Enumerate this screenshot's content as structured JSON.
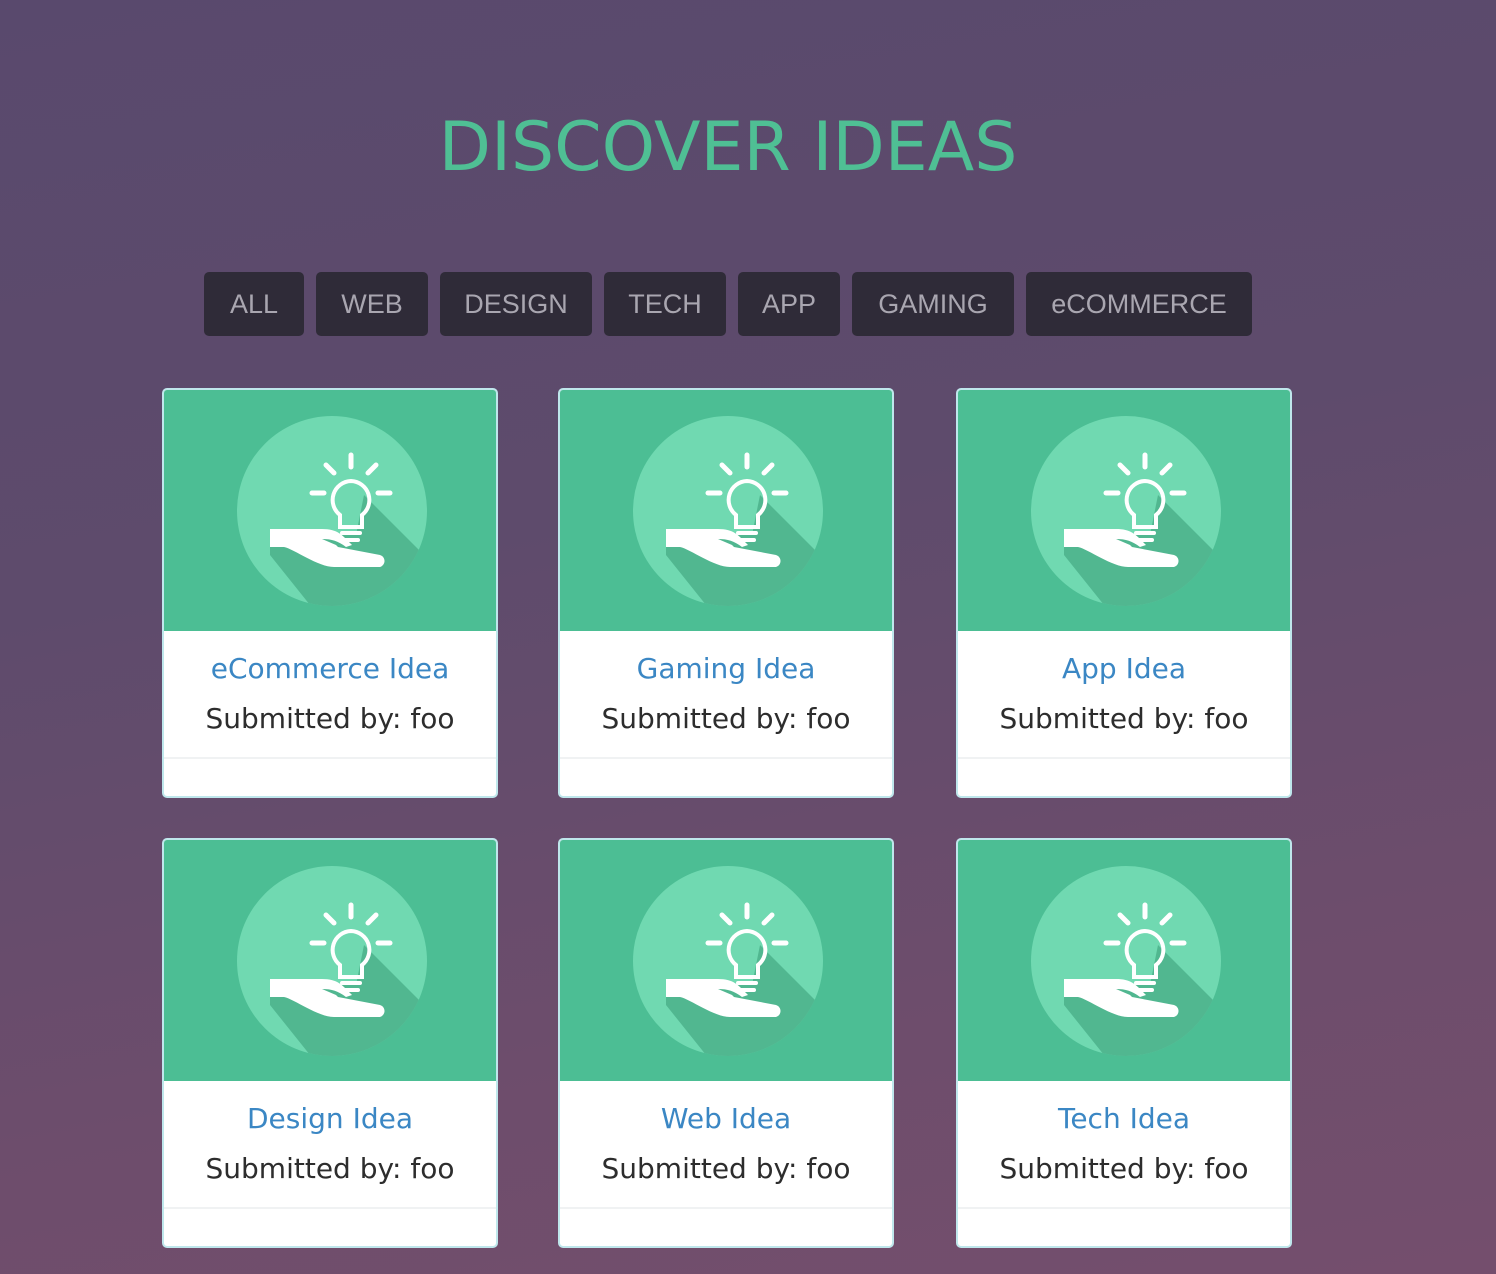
{
  "header": {
    "title": "DISCOVER IDEAS"
  },
  "filters": [
    {
      "label": "ALL"
    },
    {
      "label": "WEB"
    },
    {
      "label": "DESIGN"
    },
    {
      "label": "TECH"
    },
    {
      "label": "APP"
    },
    {
      "label": "GAMING"
    },
    {
      "label": "eCOMMERCE"
    }
  ],
  "cards": [
    {
      "title": "eCommerce Idea",
      "submitted": "Submitted by: foo",
      "icon": "lightbulb-hand-icon"
    },
    {
      "title": "Gaming Idea",
      "submitted": "Submitted by: foo",
      "icon": "lightbulb-hand-icon"
    },
    {
      "title": "App Idea",
      "submitted": "Submitted by: foo",
      "icon": "lightbulb-hand-icon"
    },
    {
      "title": "Design Idea",
      "submitted": "Submitted by: foo",
      "icon": "lightbulb-hand-icon"
    },
    {
      "title": "Web Idea",
      "submitted": "Submitted by: foo",
      "icon": "lightbulb-hand-icon"
    },
    {
      "title": "Tech Idea",
      "submitted": "Submitted by: foo",
      "icon": "lightbulb-hand-icon"
    }
  ],
  "colors": {
    "accent": "#4fbf94",
    "card_hero": "#4cbe94",
    "icon_circle": "#70d9b1",
    "link": "#3b87c4",
    "filter_bg": "#2f2b38"
  }
}
